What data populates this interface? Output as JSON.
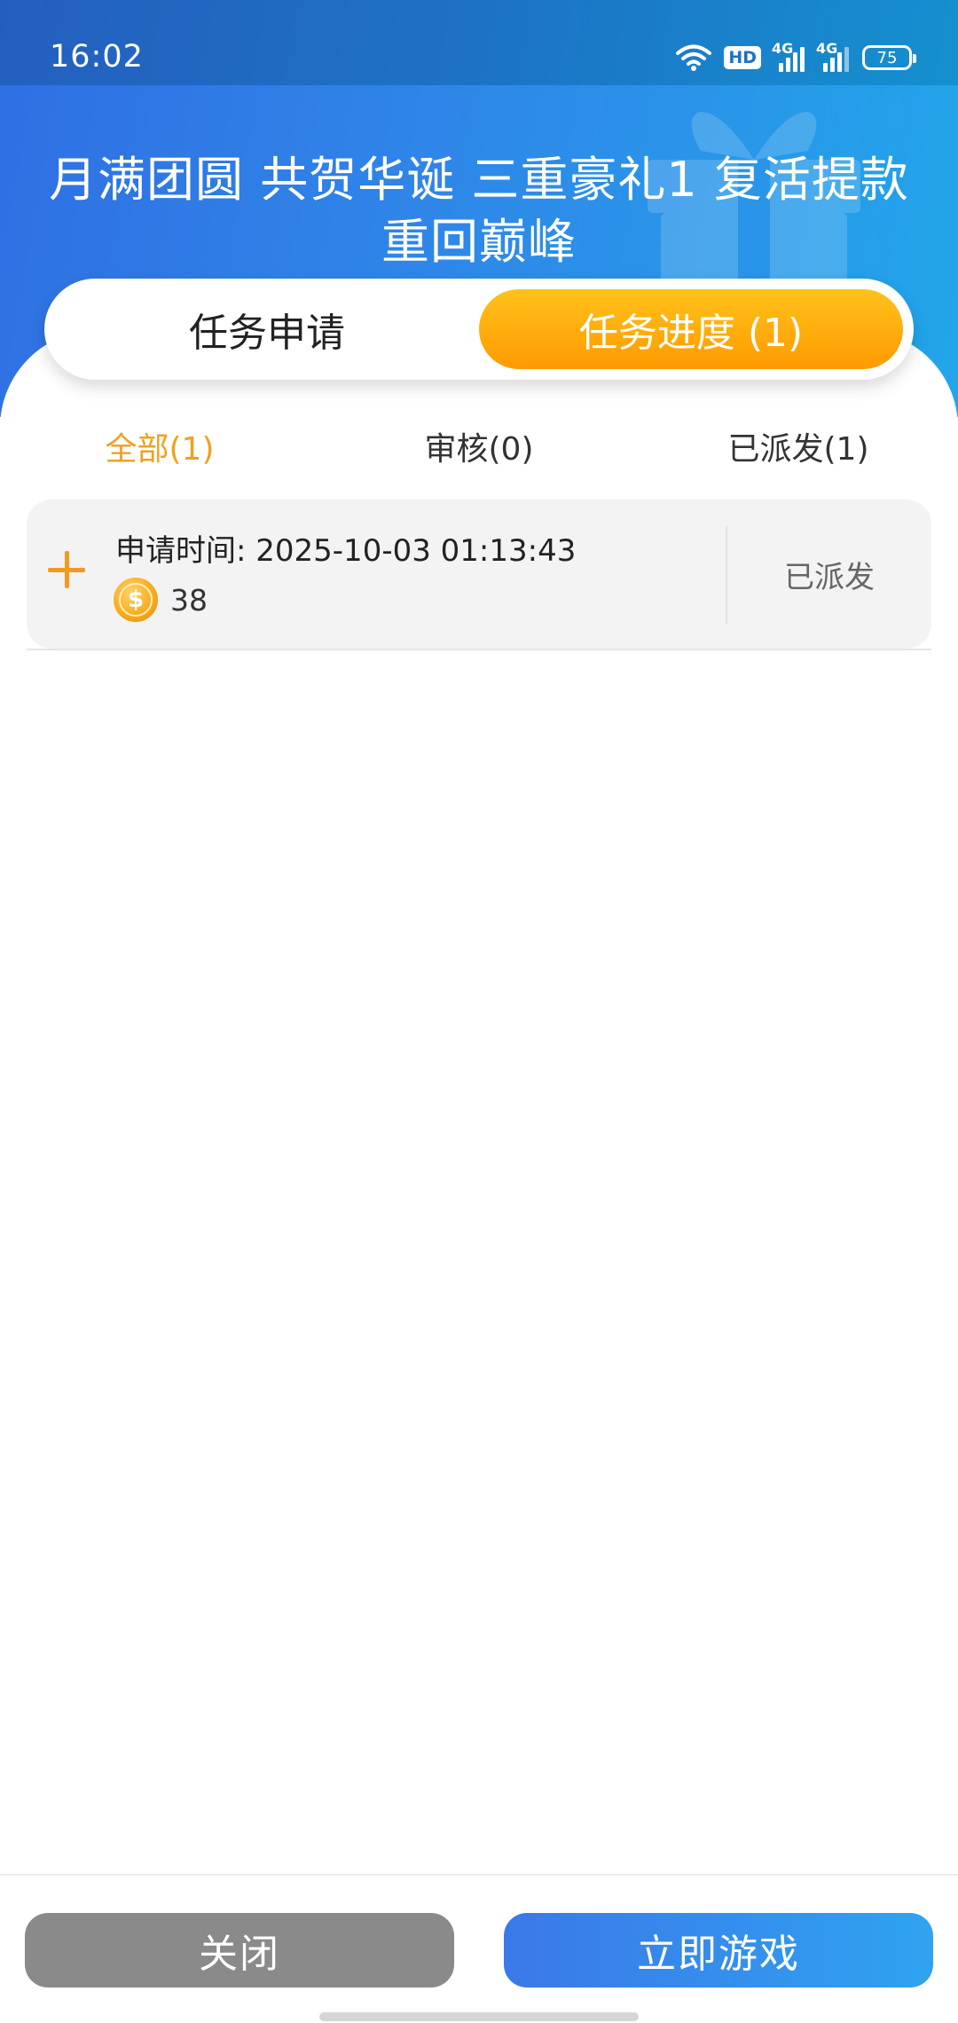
{
  "status_bar": {
    "time": "16:02",
    "hd_label": "HD",
    "network_labels": [
      "4G",
      "4G"
    ],
    "battery": "75"
  },
  "banner": {
    "title": "月满团圆 共贺华诞 三重豪礼1 复活提款重回巅峰",
    "background_colors": [
      "#2f6fe3",
      "#22a6ea"
    ]
  },
  "main_tabs": [
    {
      "label": "任务申请",
      "active": false
    },
    {
      "label": "任务进度 (1)",
      "active": true
    }
  ],
  "sub_tabs": [
    {
      "label": "全部(1)",
      "active": true
    },
    {
      "label": "审核(0)",
      "active": false
    },
    {
      "label": "已派发(1)",
      "active": false
    }
  ],
  "records": [
    {
      "time_label": "申请时间: 2025-10-03 01:13:43",
      "amount": "38",
      "status": "已派发",
      "coin_symbol": "$"
    }
  ],
  "footer": {
    "close_label": "关闭",
    "play_label": "立即游戏"
  },
  "colors": {
    "accent_orange": "#ff9a00",
    "active_subtab": "#f0a020",
    "play_button": "#3b78e8",
    "close_button": "#8a8a8a"
  }
}
